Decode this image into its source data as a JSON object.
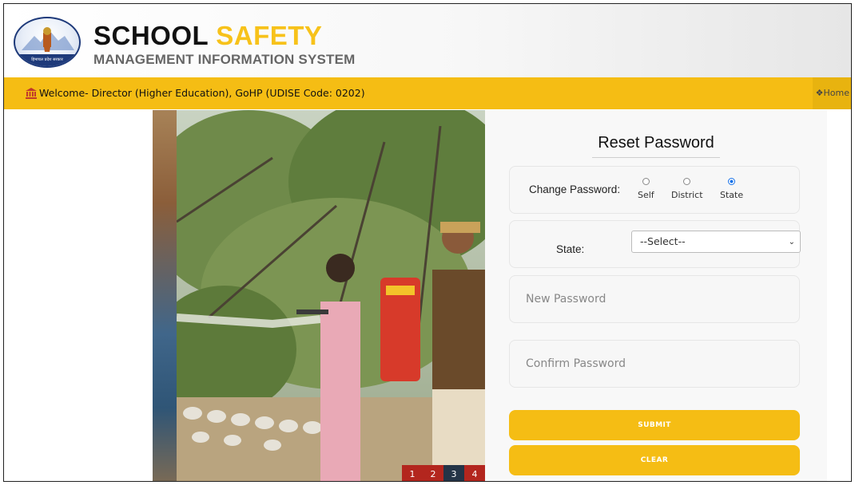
{
  "header": {
    "brand_school": "SCHOOL",
    "brand_safety": "SAFETY",
    "brand_subtitle": "MANAGEMENT INFORMATION SYSTEM",
    "logo_text": "हिमाचल प्रदेश सरकार"
  },
  "welcome": {
    "text": "Welcome- Director (Higher Education), GoHP (UDISE Code: 0202)",
    "icon": "bank-icon",
    "home_label": "Home",
    "home_icon": "home-icon"
  },
  "carousel": {
    "pages": [
      "1",
      "2",
      "3",
      "4"
    ],
    "active_page": "3"
  },
  "form": {
    "title": "Reset Password",
    "change_password_label": "Change Password:",
    "radio_options": [
      {
        "label": "Self",
        "checked": false
      },
      {
        "label": "District",
        "checked": false
      },
      {
        "label": "State",
        "checked": true
      }
    ],
    "state_label": "State:",
    "state_select_value": "--Select--",
    "new_password_placeholder": "New Password",
    "confirm_password_placeholder": "Confirm Password",
    "submit_label": "SUBMIT",
    "clear_label": "CLEAR"
  },
  "colors": {
    "accent": "#f5bd14",
    "brand_yellow": "#f7c21a",
    "pager_red": "#b3261e",
    "pager_active": "#243447"
  }
}
